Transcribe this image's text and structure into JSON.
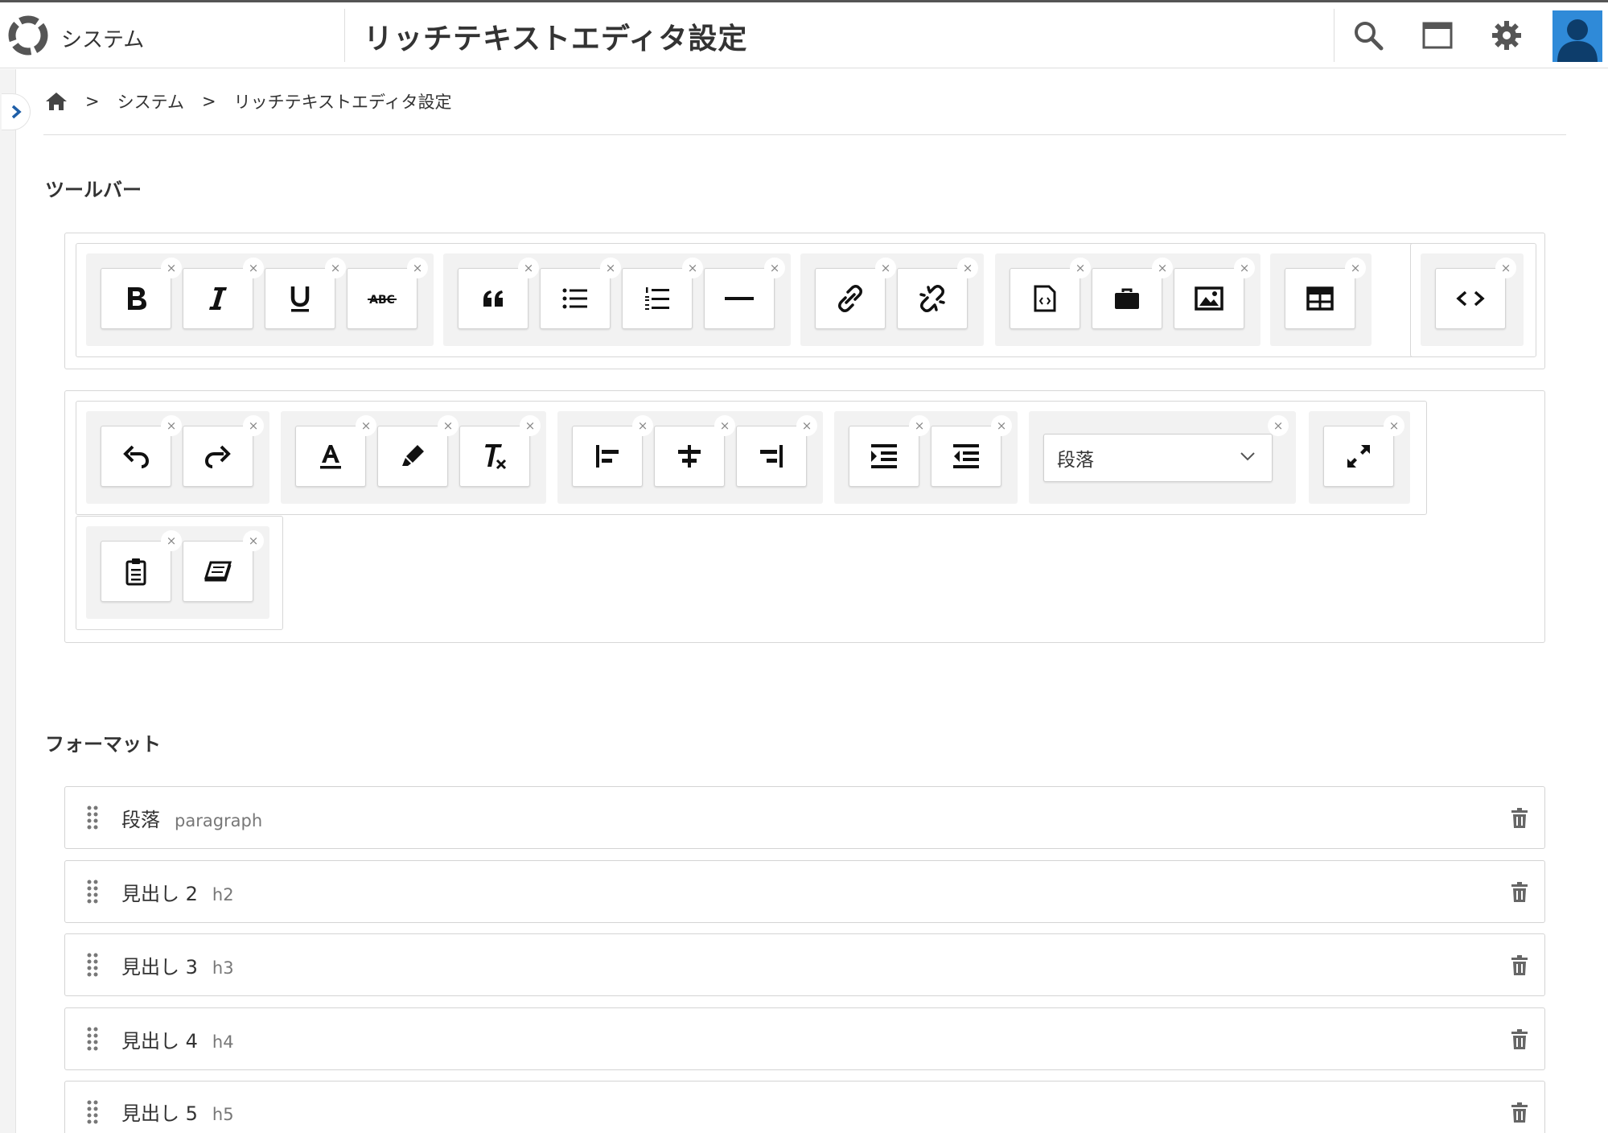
{
  "header": {
    "app_name": "システム",
    "page_title": "リッチテキストエディタ設定",
    "icons": [
      "search-icon",
      "window-icon",
      "gear-icon",
      "user-avatar-icon"
    ]
  },
  "breadcrumb": {
    "sep": ">",
    "items": [
      "システム",
      "リッチテキストエディタ設定"
    ]
  },
  "toolbar_section": {
    "title": "ツールバー",
    "remove_glyph": "×",
    "paragraph_select_value": "段落"
  },
  "format_section": {
    "title": "フォーマット",
    "items": [
      {
        "label": "段落",
        "tag": "paragraph"
      },
      {
        "label": "見出し 2",
        "tag": "h2"
      },
      {
        "label": "見出し 3",
        "tag": "h3"
      },
      {
        "label": "見出し 4",
        "tag": "h4"
      },
      {
        "label": "見出し 5",
        "tag": "h5"
      }
    ]
  },
  "colors": {
    "accent": "#2f8ad8",
    "sidebar_arrow": "#1f5fa8",
    "group_bg": "#f2f2f2",
    "border": "#d7d7d7"
  }
}
